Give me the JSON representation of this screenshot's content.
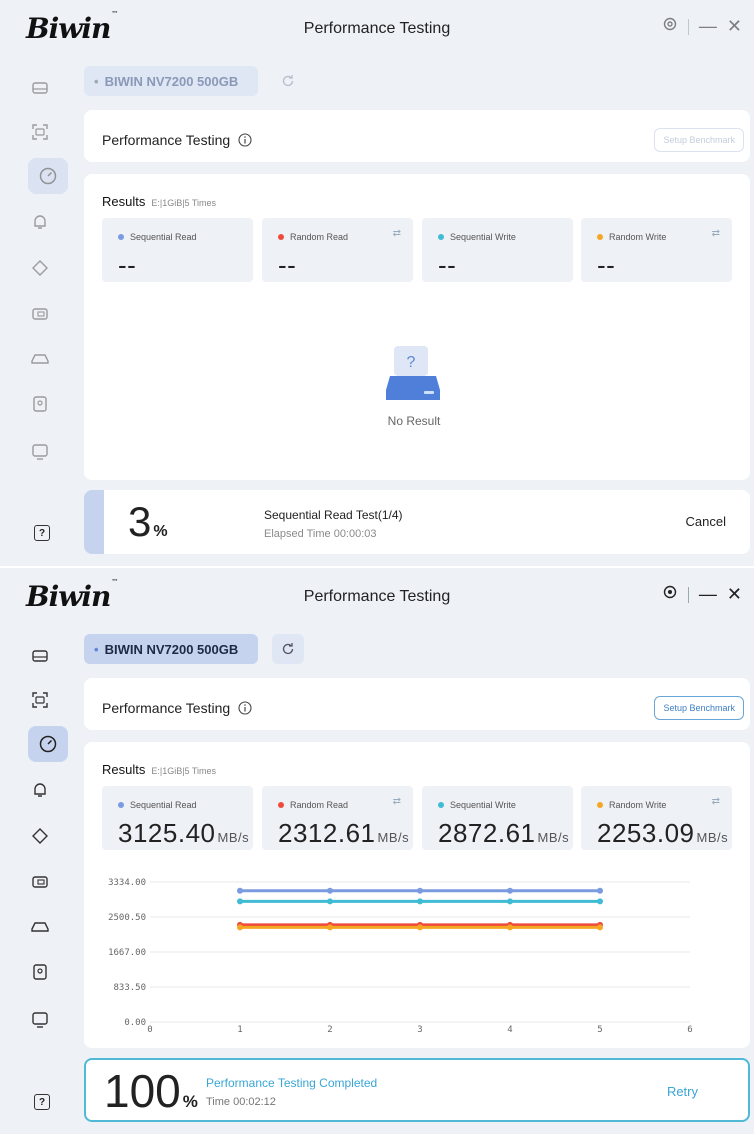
{
  "colors": {
    "seq_read": "#7b9be0",
    "rand_read": "#ee4b3c",
    "seq_write": "#3fbcd4",
    "rand_write": "#f5a623",
    "accent": "#4fb9d6"
  },
  "window1": {
    "title": "Performance Testing",
    "device": "BIWIN NV7200 500GB",
    "panel_title": "Performance Testing",
    "setup_label": "Setup Benchmark",
    "results_label": "Results",
    "results_meta": "E:|1GiB|5 Times",
    "metrics": [
      {
        "name": "Sequential Read",
        "value": "--"
      },
      {
        "name": "Random Read",
        "value": "--"
      },
      {
        "name": "Sequential Write",
        "value": "--"
      },
      {
        "name": "Random Write",
        "value": "--"
      }
    ],
    "no_result": "No Result",
    "progress": {
      "percent": "3",
      "percent_sign": "%",
      "message": "Sequential Read Test(1/4)",
      "time": "Elapsed Time 00:00:03",
      "action": "Cancel",
      "fraction": 0.03
    }
  },
  "window2": {
    "title": "Performance Testing",
    "device": "BIWIN NV7200 500GB",
    "panel_title": "Performance Testing",
    "setup_label": "Setup Benchmark",
    "results_label": "Results",
    "results_meta": "E:|1GiB|5 Times",
    "metrics": [
      {
        "name": "Sequential Read",
        "value": "3125.40",
        "unit": "MB/s"
      },
      {
        "name": "Random Read",
        "value": "2312.61",
        "unit": "MB/s"
      },
      {
        "name": "Sequential Write",
        "value": "2872.61",
        "unit": "MB/s"
      },
      {
        "name": "Random Write",
        "value": "2253.09",
        "unit": "MB/s"
      }
    ],
    "progress": {
      "percent": "100",
      "percent_sign": "%",
      "message": "Performance Testing Completed",
      "time": "Time 00:02:12",
      "action": "Retry"
    }
  },
  "chart_data": {
    "type": "line",
    "x": [
      1,
      2,
      3,
      4,
      5
    ],
    "xlim": [
      0,
      6
    ],
    "ylim": [
      0,
      3334.0
    ],
    "x_ticks": [
      "0",
      "1",
      "2",
      "3",
      "4",
      "5",
      "6"
    ],
    "y_ticks": [
      "3334.00",
      "2500.50",
      "1667.00",
      "833.50",
      "0.00"
    ],
    "y_tick_values": [
      3334.0,
      2500.5,
      1667.0,
      833.5,
      0.0
    ],
    "series": [
      {
        "name": "Sequential Read",
        "color": "#7b9be0",
        "values": [
          3125.4,
          3125.4,
          3125.4,
          3125.4,
          3125.4
        ]
      },
      {
        "name": "Sequential Write",
        "color": "#3fbcd4",
        "values": [
          2872.61,
          2872.61,
          2872.61,
          2872.61,
          2872.61
        ]
      },
      {
        "name": "Random Read",
        "color": "#ee4b3c",
        "values": [
          2312.61,
          2312.61,
          2312.61,
          2312.61,
          2312.61
        ]
      },
      {
        "name": "Random Write",
        "color": "#f5a623",
        "values": [
          2253.09,
          2253.09,
          2253.09,
          2253.09,
          2253.09
        ]
      }
    ],
    "grid": true
  }
}
